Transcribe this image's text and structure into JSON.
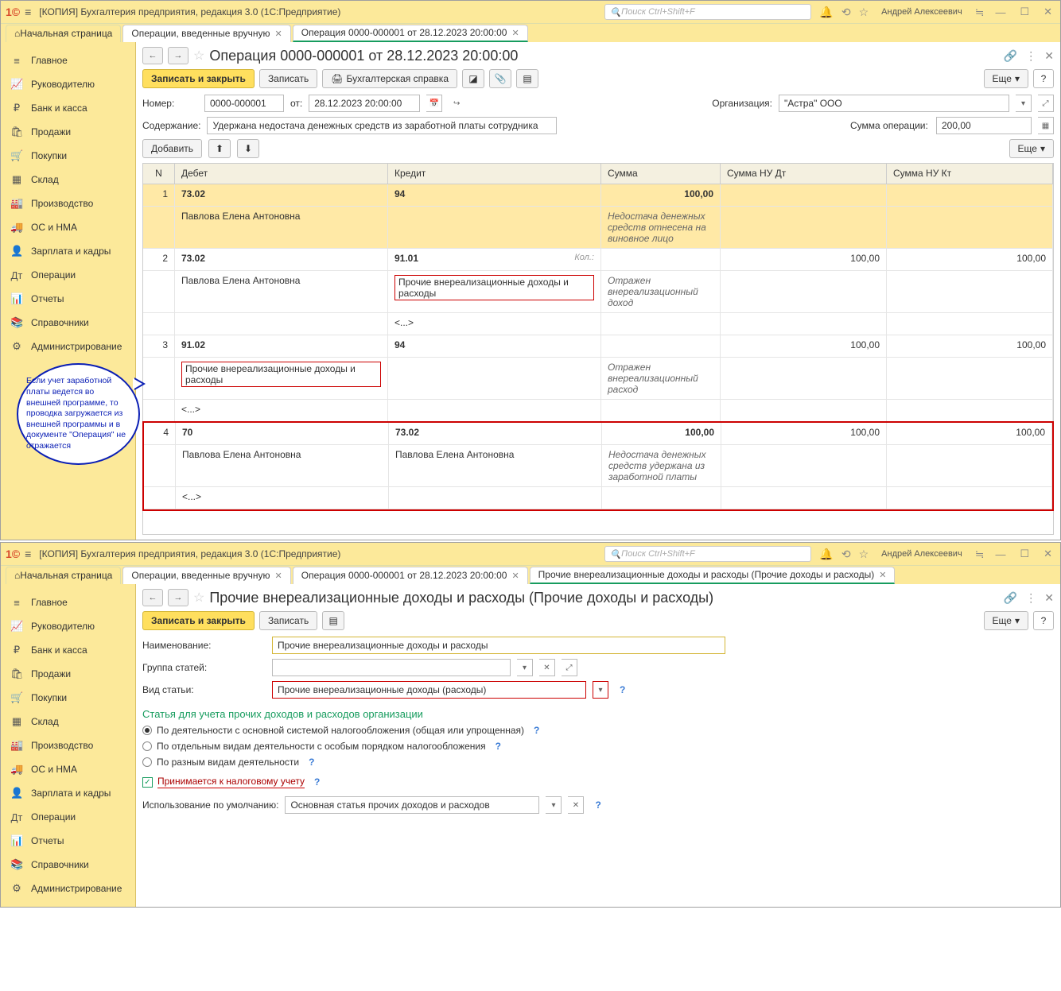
{
  "app": {
    "titlebar_text": "[КОПИЯ] Бухгалтерия предприятия, редакция 3.0  (1С:Предприятие)",
    "search_placeholder": "Поиск Ctrl+Shift+F",
    "user": "Андрей Алексеевич"
  },
  "tabs_top": {
    "home": "Начальная страница",
    "t1": "Операции, введенные вручную",
    "t2": "Операция 0000-000001 от 28.12.2023 20:00:00"
  },
  "sidebar": {
    "items": [
      {
        "icon": "≡",
        "label": "Главное"
      },
      {
        "icon": "📈",
        "label": "Руководителю"
      },
      {
        "icon": "₽",
        "label": "Банк и касса"
      },
      {
        "icon": "🛍",
        "label": "Продажи"
      },
      {
        "icon": "🛒",
        "label": "Покупки"
      },
      {
        "icon": "▦",
        "label": "Склад"
      },
      {
        "icon": "🏭",
        "label": "Производство"
      },
      {
        "icon": "🚚",
        "label": "ОС и НМА"
      },
      {
        "icon": "👤",
        "label": "Зарплата и кадры"
      },
      {
        "icon": "Дт",
        "label": "Операции"
      },
      {
        "icon": "📊",
        "label": "Отчеты"
      },
      {
        "icon": "📚",
        "label": "Справочники"
      },
      {
        "icon": "⚙",
        "label": "Администрирование"
      }
    ]
  },
  "page1": {
    "title": "Операция 0000-000001 от 28.12.2023 20:00:00",
    "btn_save_close": "Записать и закрыть",
    "btn_write": "Записать",
    "btn_cert": "Бухгалтерская справка",
    "btn_more": "Еще",
    "labels": {
      "number": "Номер:",
      "from": "от:",
      "org": "Организация:",
      "content": "Содержание:",
      "sum": "Сумма операции:"
    },
    "number": "0000-000001",
    "date": "28.12.2023 20:00:00",
    "org": "\"Астра\" ООО",
    "content": "Удержана недостача денежных средств из заработной платы сотрудника",
    "sum": "200,00",
    "btn_add": "Добавить",
    "columns": {
      "n": "N",
      "dt": "Дебет",
      "kt": "Кредит",
      "sum": "Сумма",
      "nuDt": "Сумма НУ Дт",
      "nuKt": "Сумма НУ Кт"
    },
    "rows": [
      {
        "n": "1",
        "dt": "73.02",
        "dt2": "Павлова Елена Антоновна",
        "kt": "94",
        "sum": "100,00",
        "note": "Недостача денежных средств отнесена на виновное лицо"
      },
      {
        "n": "2",
        "dt": "73.02",
        "dt2": "Павлова Елена Антоновна",
        "kt": "91.01",
        "kt2": "Прочие внереализационные доходы и расходы",
        "kt3": "<...>",
        "kol": "Кол.:",
        "sum": "",
        "note": "Отражен внереализационный доход",
        "nuDt": "100,00",
        "nuKt": "100,00"
      },
      {
        "n": "3",
        "dt": "91.02",
        "dt2": "Прочие внереализационные доходы и расходы",
        "dt3": "<...>",
        "kt": "94",
        "sum": "",
        "note": "Отражен внереализационный расход",
        "nuDt": "100,00",
        "nuKt": "100,00"
      },
      {
        "n": "4",
        "dt": "70",
        "dt2": "Павлова Елена Антоновна",
        "dt3": "<...>",
        "kt": "73.02",
        "kt2": "Павлова Елена Антоновна",
        "sum": "100,00",
        "note": "Недостача денежных средств удержана из заработной платы",
        "nuDt": "100,00",
        "nuKt": "100,00"
      }
    ],
    "bubble": "Если учет заработной платы ведется во внешней программе, то проводка загружается из внешней программы и в документе \"Операция\" не отражается"
  },
  "tabs_bottom": {
    "home": "Начальная страница",
    "t1": "Операции, введенные вручную",
    "t2": "Операция 0000-000001 от 28.12.2023 20:00:00",
    "t3": "Прочие внереализационные доходы и расходы (Прочие доходы и расходы)"
  },
  "page2": {
    "title": "Прочие внереализационные доходы и расходы (Прочие доходы и расходы)",
    "btn_save_close": "Записать и закрыть",
    "btn_write": "Записать",
    "btn_more": "Еще",
    "labels": {
      "name": "Наименование:",
      "group": "Группа статей:",
      "type": "Вид статьи:",
      "use_default": "Использование по умолчанию:"
    },
    "name": "Прочие внереализационные доходы и расходы",
    "type": "Прочие внереализационные доходы (расходы)",
    "section": "Статья для учета прочих доходов и расходов организации",
    "radio1": "По деятельности с основной системой налогообложения (общая или упрощенная)",
    "radio2": "По отдельным видам деятельности с особым порядком налогообложения",
    "radio3": "По разным видам деятельности",
    "checkbox": "Принимается к налоговому учету",
    "default_use": "Основная статья прочих доходов и расходов"
  }
}
